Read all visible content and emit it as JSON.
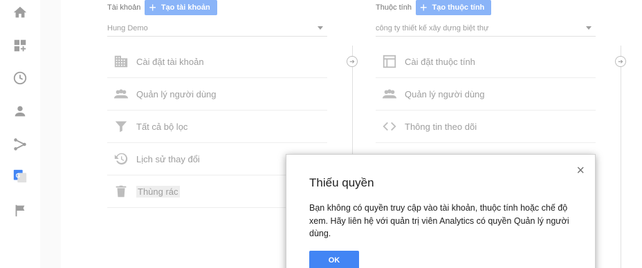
{
  "account": {
    "label": "Tài khoản",
    "create_button": "Tạo tài khoản",
    "selected": "Hung Demo",
    "items": [
      {
        "label": "Cài đặt tài khoản",
        "icon": "building-icon"
      },
      {
        "label": "Quản lý người dùng",
        "icon": "people-icon"
      },
      {
        "label": "Tất cả bộ lọc",
        "icon": "filter-icon"
      },
      {
        "label": "Lịch sử thay đổi",
        "icon": "history-icon"
      },
      {
        "label": "Thùng rác",
        "icon": "trash-icon"
      }
    ]
  },
  "property": {
    "label": "Thuộc tính",
    "create_button": "Tạo thuộc tính",
    "selected": "công ty thiết kế xây dựng biệt thự",
    "items": [
      {
        "label": "Cài đặt thuộc tính",
        "icon": "layout-icon"
      },
      {
        "label": "Quản lý người dùng",
        "icon": "people-icon"
      },
      {
        "label": "Thông tin theo dõi",
        "icon": "code-icon"
      }
    ]
  },
  "dialog": {
    "title": "Thiếu quyền",
    "message": "Bạn không có quyền truy cập vào tài khoản, thuộc tính hoặc chế độ xem. Hãy liên hệ với quản trị viên Analytics có quyền Quản lý người dùng.",
    "ok_label": "OK",
    "close_icon": "×"
  },
  "colors": {
    "primary": "#4285f4",
    "primary_light": "#8ab4f8",
    "muted_text": "#9e9e9e"
  }
}
